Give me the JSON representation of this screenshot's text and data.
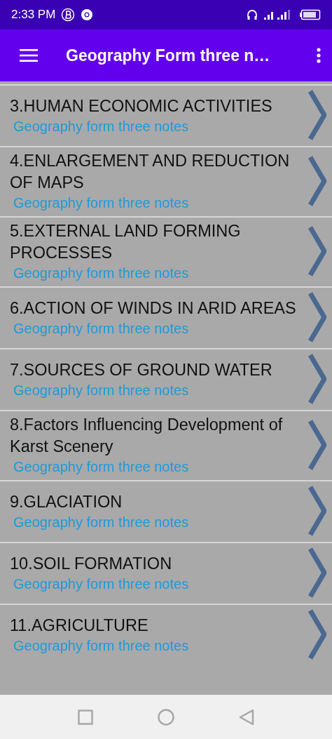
{
  "status_bar": {
    "time": "2:33 PM"
  },
  "app_bar": {
    "title": "Geography Form three n…"
  },
  "items": [
    {
      "title": "3.HUMAN ECONOMIC ACTIVITIES",
      "subtitle": "Geography form three notes"
    },
    {
      "title": "4.ENLARGEMENT AND REDUCTION OF MAPS",
      "subtitle": "Geography form three notes"
    },
    {
      "title": "5.EXTERNAL LAND FORMING PROCESSES",
      "subtitle": "Geography form three notes"
    },
    {
      "title": "6.ACTION OF WINDS IN ARID AREAS",
      "subtitle": "Geography form three notes"
    },
    {
      "title": "7.SOURCES OF GROUND WATER",
      "subtitle": "Geography form three notes"
    },
    {
      "title": "8.Factors Influencing Development of Karst Scenery",
      "subtitle": "Geography form three notes"
    },
    {
      "title": "9.GLACIATION",
      "subtitle": "Geography form three notes"
    },
    {
      "title": "10.SOIL FORMATION",
      "subtitle": "Geography form three notes"
    },
    {
      "title": "11.AGRICULTURE",
      "subtitle": "Geography form three notes"
    }
  ]
}
